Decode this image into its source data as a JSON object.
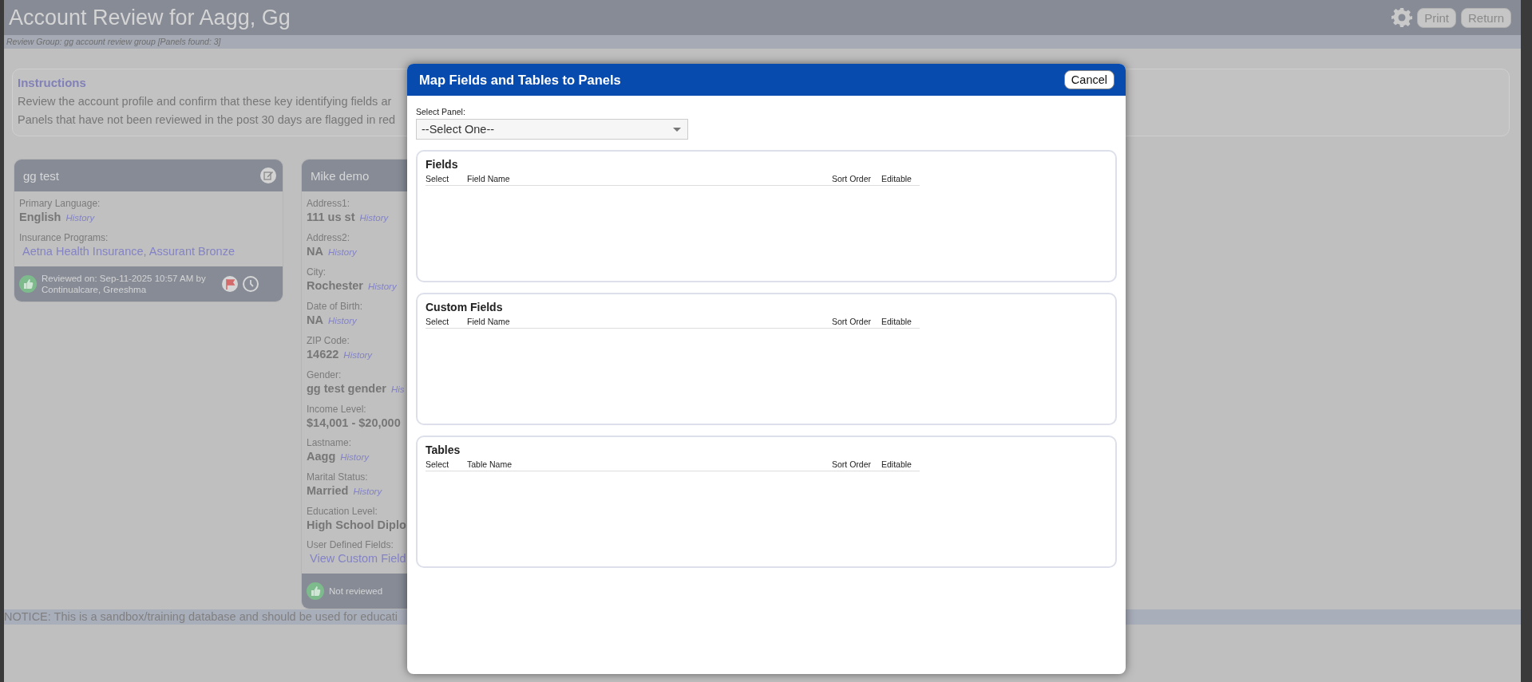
{
  "header": {
    "title": "Account Review for Aagg, Gg",
    "buttons": [
      "Print",
      "Return"
    ]
  },
  "subheader": "Review Group: gg account review group [Panels found: 3]",
  "instructions": {
    "title": "Instructions",
    "lines": [
      "Review the account profile and confirm that these key identifying fields ar",
      "Panels that have not been reviewed in the post 30 days are flagged in red"
    ]
  },
  "panels": [
    {
      "title": "gg test",
      "fields": [
        {
          "kind": "text",
          "label": "Primary Language:",
          "value": "English",
          "history": "History"
        },
        {
          "kind": "link",
          "label": "Insurance Programs:",
          "value": "Aetna Health Insurance, Assurant Bronze"
        }
      ],
      "footer": {
        "kind": "reviewed",
        "text": "Reviewed on: Sep-11-2025 10:57 AM by Continualcare, Greeshma"
      }
    },
    {
      "title": "Mike demo",
      "fields": [
        {
          "kind": "text",
          "label": "Address1:",
          "value": "111 us st",
          "history": "History"
        },
        {
          "kind": "text",
          "label": "Address2:",
          "value": "NA",
          "history": "History"
        },
        {
          "kind": "text",
          "label": "City:",
          "value": "Rochester",
          "history": "History"
        },
        {
          "kind": "text",
          "label": "Date of Birth:",
          "value": "NA",
          "history": "History"
        },
        {
          "kind": "text",
          "label": "ZIP Code:",
          "value": "14622",
          "history": "History"
        },
        {
          "kind": "text",
          "label": "Gender:",
          "value": "gg test gender",
          "history": "His"
        },
        {
          "kind": "text",
          "label": "Income Level:",
          "value": "$14,001 - $20,000"
        },
        {
          "kind": "text",
          "label": "Lastname:",
          "value": "Aagg",
          "history": "History"
        },
        {
          "kind": "text",
          "label": "Marital Status:",
          "value": "Married",
          "history": "History"
        },
        {
          "kind": "text",
          "label": "Education Level:",
          "value": "High School Diplo"
        },
        {
          "kind": "link",
          "label": "User Defined Fields:",
          "value": "View Custom Field"
        }
      ],
      "footer": {
        "kind": "not_reviewed",
        "text": "Not reviewed"
      }
    }
  ],
  "notice": "NOTICE: This is a sandbox/training database and should be used for educati",
  "modal": {
    "title": "Map Fields and Tables to Panels",
    "cancel": "Cancel",
    "select_label": "Select Panel:",
    "select_value": "--Select One--",
    "sections": [
      {
        "title": "Fields",
        "columns": [
          "Select",
          "Field Name",
          "Sort Order",
          "Editable"
        ]
      },
      {
        "title": "Custom Fields",
        "columns": [
          "Select",
          "Field Name",
          "Sort Order",
          "Editable"
        ]
      },
      {
        "title": "Tables",
        "columns": [
          "Select",
          "Table Name",
          "Sort Order",
          "Editable"
        ]
      }
    ]
  }
}
